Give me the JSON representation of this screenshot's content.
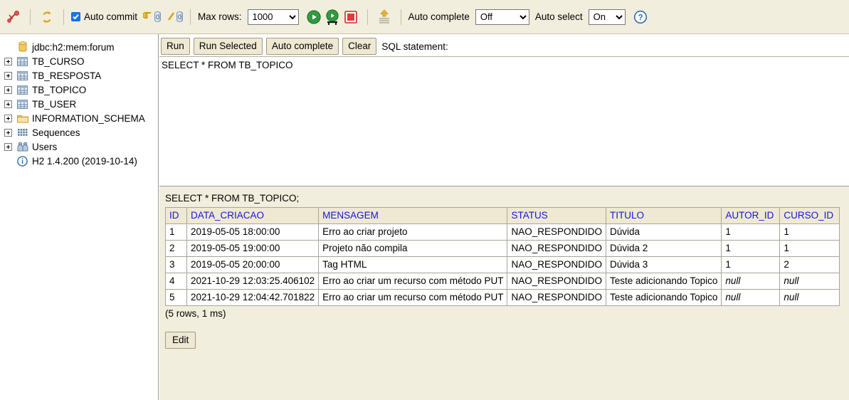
{
  "toolbar": {
    "disconnect_icon": "disconnect-icon",
    "refresh_icon": "refresh-icon",
    "auto_commit_label": "Auto commit",
    "auto_commit_checked": true,
    "commit_icon": "commit-icon",
    "commit_count": "0",
    "rollback_icon": "rollback-icon",
    "rollback_count": "0",
    "max_rows_label": "Max rows:",
    "max_rows_value": "1000",
    "max_rows_options": [
      "1000"
    ],
    "run_icon": "run-icon",
    "run_selected_icon": "run-selected-icon",
    "stop_icon": "stop-icon",
    "commit_text_icon": "upload-icon",
    "auto_complete_label": "Auto complete",
    "auto_complete_value": "Off",
    "auto_complete_options": [
      "Off"
    ],
    "auto_select_label": "Auto select",
    "auto_select_value": "On",
    "auto_select_options": [
      "On"
    ],
    "help_icon": "help-icon"
  },
  "sidebar": {
    "items": [
      {
        "label": "jdbc:h2:mem:forum",
        "icon": "database-icon",
        "expandable": false,
        "indent": 0
      },
      {
        "label": "TB_CURSO",
        "icon": "table-icon",
        "expandable": true,
        "indent": 1
      },
      {
        "label": "TB_RESPOSTA",
        "icon": "table-icon",
        "expandable": true,
        "indent": 1
      },
      {
        "label": "TB_TOPICO",
        "icon": "table-icon",
        "expandable": true,
        "indent": 1
      },
      {
        "label": "TB_USER",
        "icon": "table-icon",
        "expandable": true,
        "indent": 1
      },
      {
        "label": "INFORMATION_SCHEMA",
        "icon": "folder-icon",
        "expandable": true,
        "indent": 1
      },
      {
        "label": "Sequences",
        "icon": "sequences-icon",
        "expandable": true,
        "indent": 1
      },
      {
        "label": "Users",
        "icon": "users-icon",
        "expandable": true,
        "indent": 1
      },
      {
        "label": "H2 1.4.200 (2019-10-14)",
        "icon": "info-icon",
        "expandable": false,
        "indent": 0
      }
    ]
  },
  "query": {
    "run_label": "Run",
    "run_selected_label": "Run Selected",
    "auto_complete_label": "Auto complete",
    "clear_label": "Clear",
    "sql_statement_label": "SQL statement:",
    "sql_text": "SELECT * FROM TB_TOPICO"
  },
  "results": {
    "executed_query": "SELECT * FROM TB_TOPICO;",
    "columns": [
      "ID",
      "DATA_CRIACAO",
      "MENSAGEM",
      "STATUS",
      "TITULO",
      "AUTOR_ID",
      "CURSO_ID"
    ],
    "rows": [
      [
        "1",
        "2019-05-05 18:00:00",
        "Erro ao criar projeto",
        "NAO_RESPONDIDO",
        "Dúvida",
        "1",
        "1"
      ],
      [
        "2",
        "2019-05-05 19:00:00",
        "Projeto não compila",
        "NAO_RESPONDIDO",
        "Dúvida 2",
        "1",
        "1"
      ],
      [
        "3",
        "2019-05-05 20:00:00",
        "Tag HTML",
        "NAO_RESPONDIDO",
        "Dúvida 3",
        "1",
        "2"
      ],
      [
        "4",
        "2021-10-29 12:03:25.406102",
        "Erro ao criar um recurso com método PUT",
        "NAO_RESPONDIDO",
        "Teste adicionando Topico",
        "null",
        "null"
      ],
      [
        "5",
        "2021-10-29 12:04:42.701822",
        "Erro ao criar um recurso com método PUT",
        "NAO_RESPONDIDO",
        "Teste adicionando Topico",
        "null",
        "null"
      ]
    ],
    "status": "(5 rows, 1 ms)",
    "edit_label": "Edit"
  },
  "colors": {
    "toolbar_bg": "#f2eedd",
    "header_text": "#1414e0",
    "accent_green": "#2f9e3f",
    "accent_red": "#d8242a",
    "accent_gold": "#e0a529",
    "accent_blue": "#1a73e8"
  }
}
